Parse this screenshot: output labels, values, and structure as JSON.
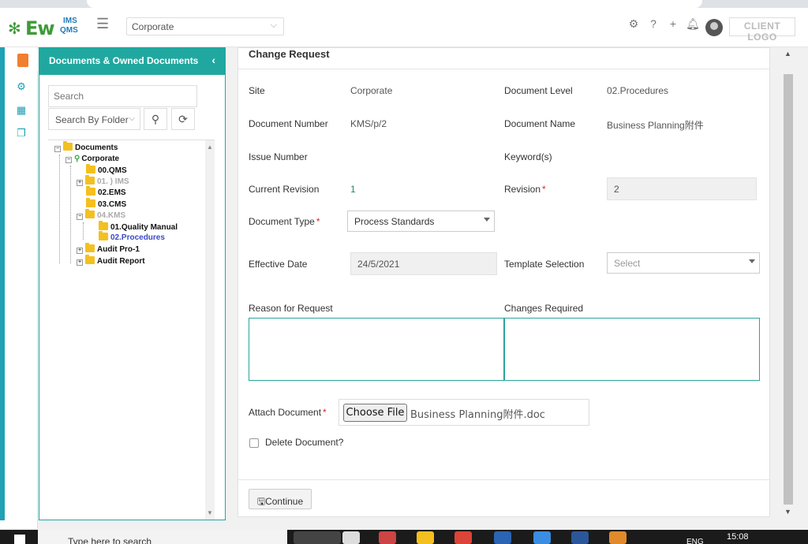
{
  "header": {
    "logo_ew": "Ew",
    "logo_ims": "IMS",
    "logo_qms": "QMS",
    "site_select_value": "Corporate",
    "client_logo_text": "CLIENT LOGO",
    "icons": [
      "gear-icon",
      "help-icon",
      "plus-icon",
      "bell-icon",
      "avatar"
    ]
  },
  "left_panel": {
    "title": "Documents & Owned Documents",
    "search_placeholder": "Search",
    "search_by_value": "Search By Folder",
    "tree": [
      {
        "label": "Documents",
        "level": 0,
        "state": "normal"
      },
      {
        "label": "Corporate",
        "level": 1,
        "state": "normal"
      },
      {
        "label": "00.QMS",
        "level": 2,
        "state": "normal"
      },
      {
        "label": "01. ) IMS",
        "level": 2,
        "state": "dim"
      },
      {
        "label": "02.EMS",
        "level": 2,
        "state": "normal"
      },
      {
        "label": "03.CMS",
        "level": 2,
        "state": "normal"
      },
      {
        "label": "04.KMS",
        "level": 2,
        "state": "dim"
      },
      {
        "label": "01.Quality Manual",
        "level": 3,
        "state": "normal"
      },
      {
        "label": "02.Procedures",
        "level": 3,
        "state": "selected"
      },
      {
        "label": "Audit Pro-1",
        "level": 2,
        "state": "normal"
      },
      {
        "label": "Audit Report",
        "level": 2,
        "state": "normal"
      }
    ]
  },
  "form": {
    "title": "Change Request",
    "site_label": "Site",
    "site_value": "Corporate",
    "doc_level_label": "Document Level",
    "doc_level_value": "02.Procedures",
    "doc_number_label": "Document Number",
    "doc_number_value": "KMS/p/2",
    "doc_name_label": "Document Name",
    "doc_name_value": "Business Planning附件",
    "issue_number_label": "Issue Number",
    "keywords_label": "Keyword(s)",
    "current_revision_label": "Current Revision",
    "current_revision_value": "1",
    "revision_label": "Revision",
    "revision_value": "2",
    "doc_type_label": "Document Type",
    "doc_type_value": "Process Standards",
    "effective_date_label": "Effective Date",
    "effective_date_value": "24/5/2021",
    "template_label": "Template Selection",
    "template_placeholder": "Select",
    "reason_label": "Reason for Request",
    "changes_label": "Changes Required",
    "attach_label": "Attach Document",
    "choose_file_label": "Choose File",
    "file_name": "Business Planning附件.doc",
    "delete_label": "Delete Document?",
    "continue_label": "Continue",
    "required_mark": "*"
  },
  "taskbar": {
    "search_text": "Type here to search",
    "language": "ENG",
    "time": "15:08"
  }
}
